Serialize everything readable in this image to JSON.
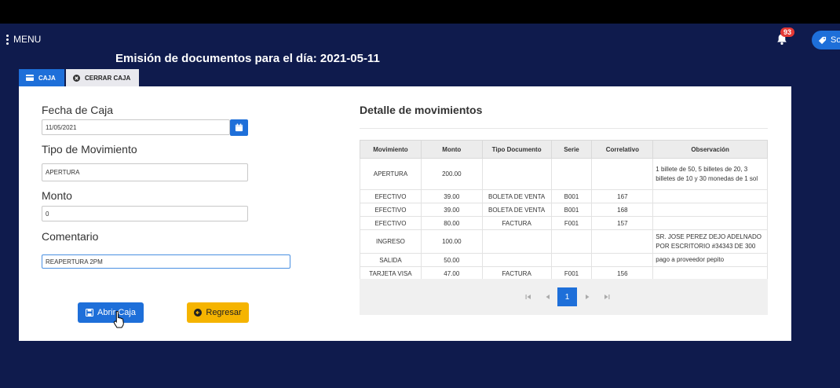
{
  "header": {
    "menu_label": "MENU",
    "notification_count": "93",
    "sop_label": "So"
  },
  "page_title": "Emisión de documentos para el día: 2021-05-11",
  "tabs": [
    {
      "label": "CAJA",
      "icon": "register-icon"
    },
    {
      "label": "CERRAR CAJA",
      "icon": "close-circle-icon"
    }
  ],
  "form": {
    "fecha_label": "Fecha de Caja",
    "fecha_value": "11/05/2021",
    "tipo_label": "Tipo de Movimiento",
    "tipo_value": "APERTURA",
    "monto_label": "Monto",
    "monto_value": "0",
    "comentario_label": "Comentario",
    "comentario_value": "REAPERTURA 2PM"
  },
  "buttons": {
    "abrir": "Abrir Caja",
    "regresar": "Regresar"
  },
  "detalle": {
    "title": "Detalle de movimientos",
    "columns": [
      "Movimiento",
      "Monto",
      "Tipo Documento",
      "Serie",
      "Correlativo",
      "Observación"
    ],
    "rows": [
      [
        "APERTURA",
        "200.00",
        "",
        "",
        "",
        "1 billete de 50, 5 billetes de 20, 3 billetes de 10 y 30 monedas de 1 sol"
      ],
      [
        "EFECTIVO",
        "39.00",
        "BOLETA DE VENTA",
        "B001",
        "167",
        ""
      ],
      [
        "EFECTIVO",
        "39.00",
        "BOLETA DE VENTA",
        "B001",
        "168",
        ""
      ],
      [
        "EFECTIVO",
        "80.00",
        "FACTURA",
        "F001",
        "157",
        ""
      ],
      [
        "INGRESO",
        "100.00",
        "",
        "",
        "",
        "SR. JOSE PEREZ DEJO ADELNADO POR ESCRITORIO #34343 DE 300"
      ],
      [
        "SALIDA",
        "50.00",
        "",
        "",
        "",
        "pago a proveedor pepito"
      ],
      [
        "TARJETA VISA",
        "47.00",
        "FACTURA",
        "F001",
        "156",
        ""
      ]
    ],
    "pagination": {
      "current_page": "1"
    }
  },
  "colors": {
    "background": "#0f1b4d",
    "primary": "#1e6fd9",
    "warning": "#f5b400",
    "badge": "#e53935"
  }
}
